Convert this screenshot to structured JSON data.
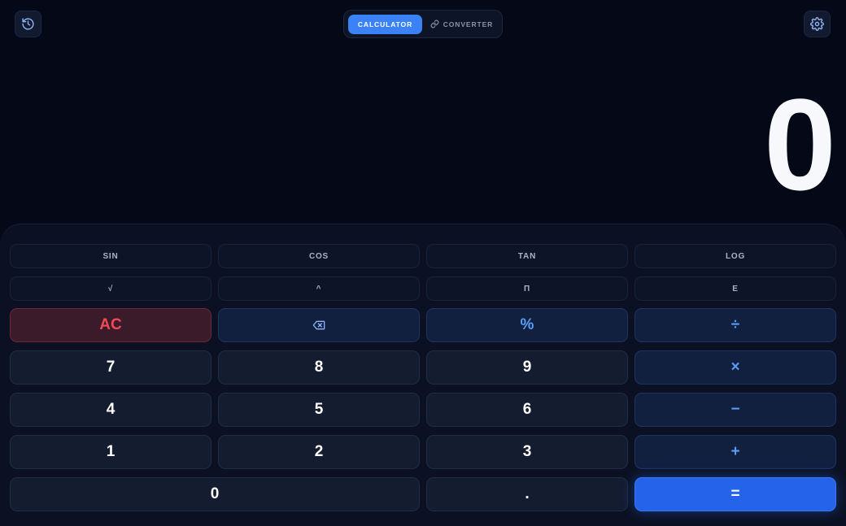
{
  "header": {
    "history_icon": "history-icon",
    "settings_icon": "gear-icon",
    "tabs": [
      {
        "label": "CALCULATOR",
        "active": true
      },
      {
        "label": "CONVERTER",
        "active": false,
        "icon": "link-icon"
      }
    ]
  },
  "display": {
    "value": "0"
  },
  "keypad": {
    "scientific": [
      "SIN",
      "COS",
      "TAN",
      "LOG",
      "√",
      "^",
      "Π",
      "E"
    ],
    "clear": "AC",
    "backspace_icon": "backspace-icon",
    "percent": "%",
    "divide": "÷",
    "multiply": "×",
    "subtract": "−",
    "add": "+",
    "equals": "=",
    "decimal": ".",
    "digits": [
      "0",
      "1",
      "2",
      "3",
      "4",
      "5",
      "6",
      "7",
      "8",
      "9"
    ]
  },
  "colors": {
    "background": "#040817",
    "accent": "#3b82f6",
    "equals": "#2563eb",
    "clear_text": "#ef4a57",
    "operator_text": "#5b9cf7"
  }
}
